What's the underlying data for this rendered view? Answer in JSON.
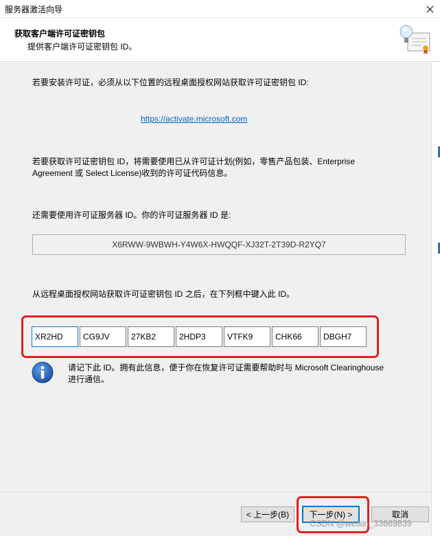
{
  "window": {
    "title": "服务器激活向导"
  },
  "header": {
    "title": "获取客户端许可证密钥包",
    "subtitle": "提供客户端许可证密钥包 ID。"
  },
  "body": {
    "intro": "若要安装许可证，必须从以下位置的远程桌面授权网站获取许可证密钥包 ID:",
    "link": "https://activate.microsoft.com",
    "program_line1": "若要获取许可证密钥包 ID，将需要使用已从许可证计划(例如，零售产品包装、Enterprise",
    "program_line2": "Agreement 或 Select License)收到的许可证代码信息。",
    "server_id_label": "还需要使用许可证服务器 ID。你的许可证服务器 ID 是:",
    "server_id": "X6RWW-9WBWH-Y4W6X-HWQQF-XJ32T-2T39D-R2YQ7",
    "enter_label": "从远程桌面授权网站获取许可证密钥包 ID 之后，在下列框中键入此 ID。",
    "key_parts": [
      "XR2HD",
      "CG9JV",
      "27KB2",
      "2HDP3",
      "VTFK9",
      "CHK66",
      "DBGH7"
    ],
    "info_line1": "请记下此 ID。拥有此信息，便于你在恢复许可证需要帮助时与 Microsoft Clearinghouse",
    "info_line2": "进行通信。"
  },
  "footer": {
    "back_label": "< 上一步(B)",
    "next_label": "下一步(N) >",
    "cancel_label": "取消"
  },
  "watermark": "CSDN @weixin_33669839",
  "colors": {
    "highlight": "#e02020",
    "link": "#0066cc",
    "focus": "#0078d7",
    "panel": "#f0f0f0"
  },
  "icons": [
    "close-icon",
    "certificate-icon",
    "info-icon"
  ]
}
